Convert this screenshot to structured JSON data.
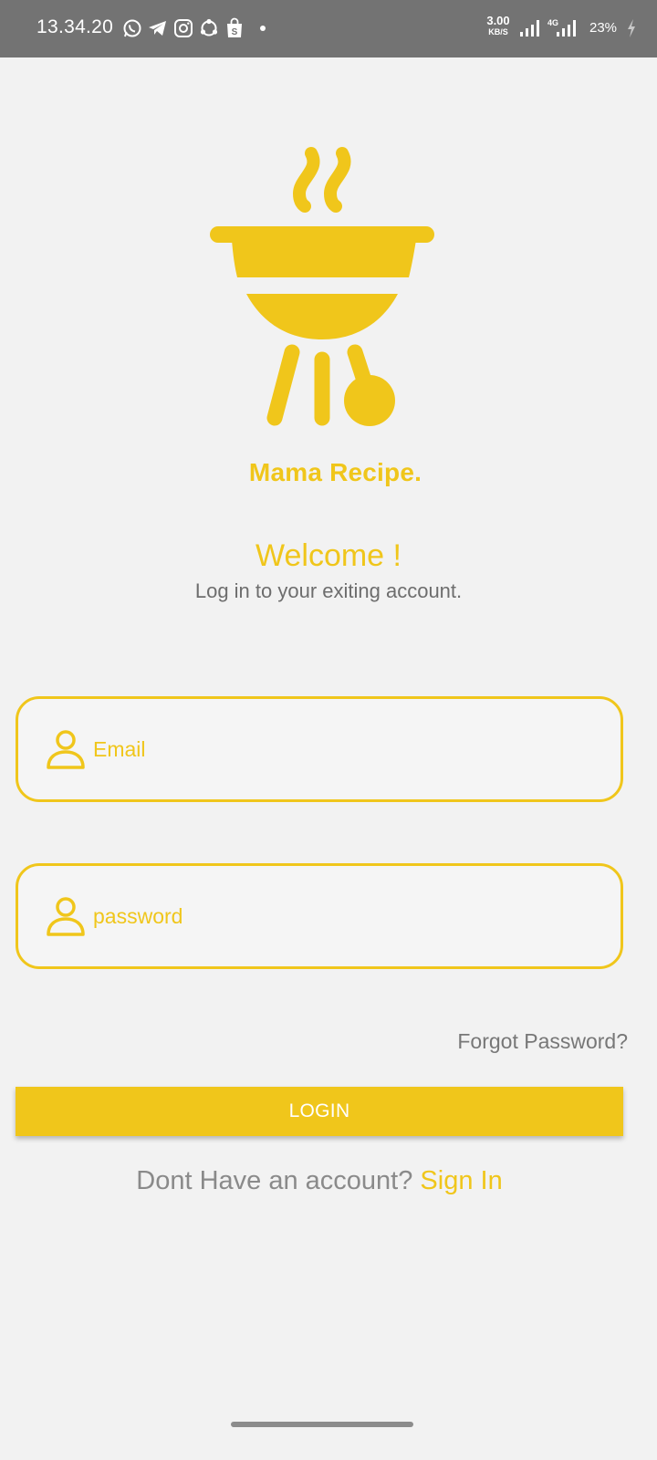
{
  "status_bar": {
    "time": "13.34.20",
    "net_speed_value": "3.00",
    "net_speed_unit": "KB/S",
    "network_type": "4G",
    "battery": "23%",
    "app_icons": [
      "whatsapp-icon",
      "telegram-icon",
      "instagram-icon",
      "sync-icon",
      "shopping-bag-icon",
      "dot-icon"
    ]
  },
  "brand": {
    "name": "Mama Recipe."
  },
  "header": {
    "welcome": "Welcome !",
    "subtitle": "Log in to your exiting account."
  },
  "form": {
    "email_placeholder": "Email",
    "email_value": "",
    "password_placeholder": "password",
    "password_value": "",
    "forgot_label": "Forgot Password?",
    "login_label": "LOGIN"
  },
  "footer": {
    "prompt": "Dont Have an account?",
    "link_label": "Sign In"
  },
  "colors": {
    "accent": "#f0c61b",
    "background": "#f2f2f2",
    "status_bar": "#737373",
    "muted_text": "#6d6d6d"
  }
}
